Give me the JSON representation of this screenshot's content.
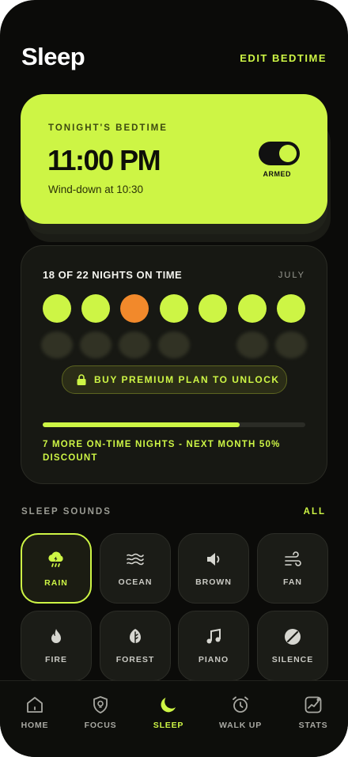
{
  "header": {
    "title": "Sleep",
    "edit_label": "EDIT BEDTIME"
  },
  "bedtime": {
    "label": "TONIGHT'S BEDTIME",
    "time": "11:00 PM",
    "winddown": "Wind-down at 10:30",
    "toggle_state": "on",
    "toggle_label": "ARMED"
  },
  "nights": {
    "title": "18 OF 22 NIGHTS ON TIME",
    "month": "JULY",
    "week": [
      "on",
      "on",
      "late",
      "on",
      "on",
      "on",
      "on"
    ],
    "unlock_label": "BUY PREMIUM PLAN TO UNLOCK",
    "progress": 0.75,
    "progress_text": "7 MORE ON-TIME NIGHTS - NEXT MONTH 50% DISCOUNT"
  },
  "sounds": {
    "title": "SLEEP SOUNDS",
    "all_label": "ALL",
    "items": [
      {
        "label": "RAIN",
        "icon": "rain-cloud-icon",
        "active": true
      },
      {
        "label": "OCEAN",
        "icon": "waves-icon",
        "active": false
      },
      {
        "label": "BROWN",
        "icon": "speaker-icon",
        "active": false
      },
      {
        "label": "FAN",
        "icon": "wind-icon",
        "active": false
      },
      {
        "label": "FIRE",
        "icon": "flame-icon",
        "active": false
      },
      {
        "label": "FOREST",
        "icon": "leaf-icon",
        "active": false
      },
      {
        "label": "PIANO",
        "icon": "music-note-icon",
        "active": false
      },
      {
        "label": "SILENCE",
        "icon": "mute-icon",
        "active": false
      }
    ]
  },
  "nav": {
    "items": [
      {
        "label": "HOME",
        "icon": "home-icon"
      },
      {
        "label": "FOCUS",
        "icon": "shield-bulb-icon"
      },
      {
        "label": "SLEEP",
        "icon": "moon-icon",
        "active": true
      },
      {
        "label": "WALK UP",
        "icon": "alarm-clock-icon"
      },
      {
        "label": "STATS",
        "icon": "stats-icon"
      }
    ]
  },
  "colors": {
    "accent": "#cdf545",
    "late": "#f2892b",
    "background": "#0b0b09"
  }
}
